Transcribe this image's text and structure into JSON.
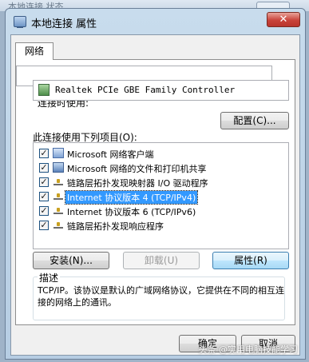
{
  "window": {
    "title": "本地连接 属性",
    "close_label": "✕"
  },
  "background_window": {
    "title": "本地连接 状态"
  },
  "tabs": [
    {
      "label": "网络",
      "selected": true
    }
  ],
  "connect_using": {
    "label": "连接时使用:",
    "adapter_name": "Realtek PCIe GBE Family Controller",
    "configure_button": "配置(C)..."
  },
  "items_section": {
    "label": "此连接使用下列项目(O):",
    "items": [
      {
        "label": "Microsoft 网络客户端",
        "checked": true,
        "icon": "network-client-icon",
        "selected": false
      },
      {
        "label": "Microsoft 网络的文件和打印机共享",
        "checked": true,
        "icon": "file-printer-sharing-icon",
        "selected": false
      },
      {
        "label": "链路层拓扑发现映射器 I/O 驱动程序",
        "checked": true,
        "icon": "protocol-icon",
        "selected": false
      },
      {
        "label": "Internet 协议版本 4 (TCP/IPv4)",
        "checked": true,
        "icon": "protocol-icon",
        "selected": true
      },
      {
        "label": "Internet 协议版本 6 (TCP/IPv6)",
        "checked": true,
        "icon": "protocol-icon",
        "selected": false
      },
      {
        "label": "链路层拓扑发现响应程序",
        "checked": true,
        "icon": "protocol-icon",
        "selected": false
      }
    ]
  },
  "action_buttons": {
    "install": "安装(N)...",
    "uninstall": "卸载(U)",
    "properties": "属性(R)"
  },
  "description": {
    "title": "描述",
    "text": "TCP/IP。该协议是默认的广域网络协议，它提供在不同的相互连接的网络上的通讯。"
  },
  "dialog_buttons": {
    "ok": "确定",
    "cancel": "取消"
  },
  "watermark": "头条 @实用电脑技能学习"
}
